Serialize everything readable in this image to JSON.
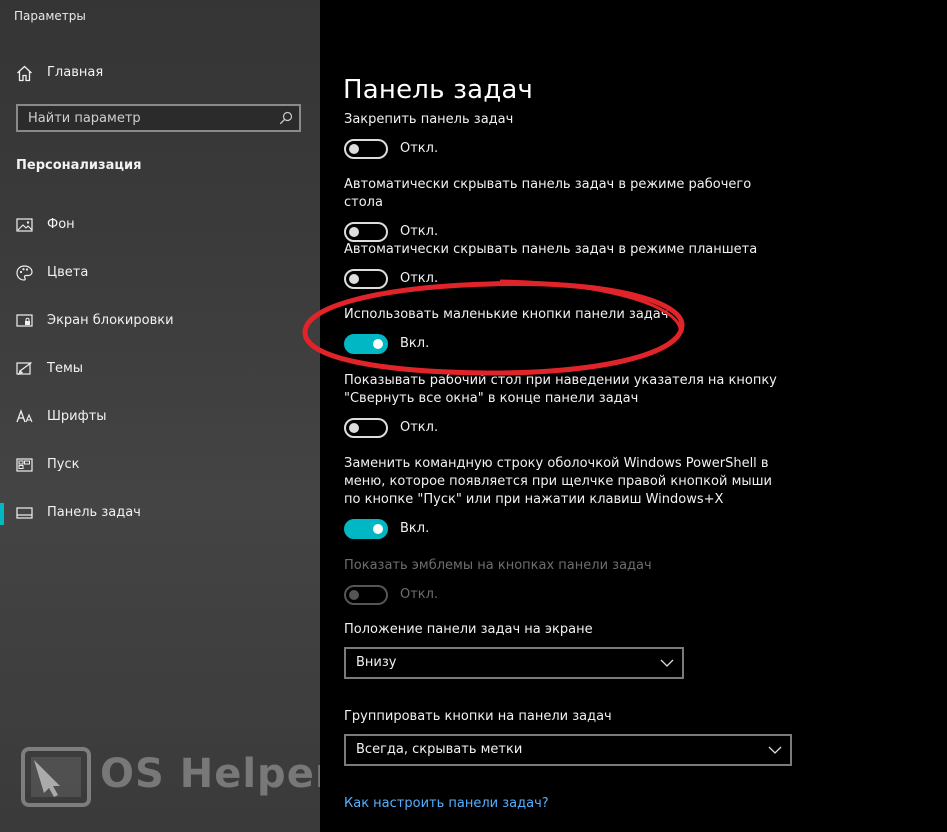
{
  "window": {
    "title": "Параметры",
    "controls": [
      "minimize-icon",
      "maximize-icon",
      "close-icon"
    ]
  },
  "sidebar": {
    "home_label": "Главная",
    "search_placeholder": "Найти параметр",
    "section_title": "Персонализация",
    "items": [
      {
        "label": "Фон",
        "icon": "picture-icon",
        "active": false
      },
      {
        "label": "Цвета",
        "icon": "palette-icon",
        "active": false
      },
      {
        "label": "Экран блокировки",
        "icon": "lock-screen-icon",
        "active": false
      },
      {
        "label": "Темы",
        "icon": "themes-icon",
        "active": false
      },
      {
        "label": "Шрифты",
        "icon": "fonts-icon",
        "active": false
      },
      {
        "label": "Пуск",
        "icon": "start-icon",
        "active": false
      },
      {
        "label": "Панель задач",
        "icon": "taskbar-icon",
        "active": true
      }
    ],
    "watermark": {
      "text": "OS Helper",
      "icon": "cursor-logo-icon"
    }
  },
  "main": {
    "title": "Панель задач",
    "settings": [
      {
        "label": "Закрепить панель задач",
        "state": "Откл.",
        "on": false,
        "disabled": false
      },
      {
        "label": "Автоматически скрывать панель задач в режиме рабочего стола",
        "state": "Откл.",
        "on": false,
        "disabled": false
      },
      {
        "label": "Автоматически скрывать панель задач в режиме планшета",
        "state": "Откл.",
        "on": false,
        "disabled": false
      },
      {
        "label": "Использовать маленькие кнопки панели задач",
        "state": "Вкл.",
        "on": true,
        "disabled": false,
        "highlighted": true
      },
      {
        "label": "Показывать рабочий стол при наведении указателя на кнопку \"Свернуть все окна\" в конце панели задач",
        "state": "Откл.",
        "on": false,
        "disabled": false
      },
      {
        "label": "Заменить командную строку оболочкой Windows PowerShell в меню, которое появляется при щелчке правой кнопкой мыши по кнопке \"Пуск\" или при нажатии клавиш Windows+X",
        "state": "Вкл.",
        "on": true,
        "disabled": false
      },
      {
        "label": "Показать эмблемы на кнопках панели задач",
        "state": "Откл.",
        "on": false,
        "disabled": true
      }
    ],
    "position": {
      "label": "Положение панели задач на экране",
      "value": "Внизу"
    },
    "grouping": {
      "label": "Группировать кнопки на панели задач",
      "value": "Всегда, скрывать метки"
    },
    "help_link": "Как настроить панели задач?"
  },
  "colors": {
    "accent": "#00b7c3",
    "annotation": "#e0242a",
    "link": "#55b0ff"
  }
}
